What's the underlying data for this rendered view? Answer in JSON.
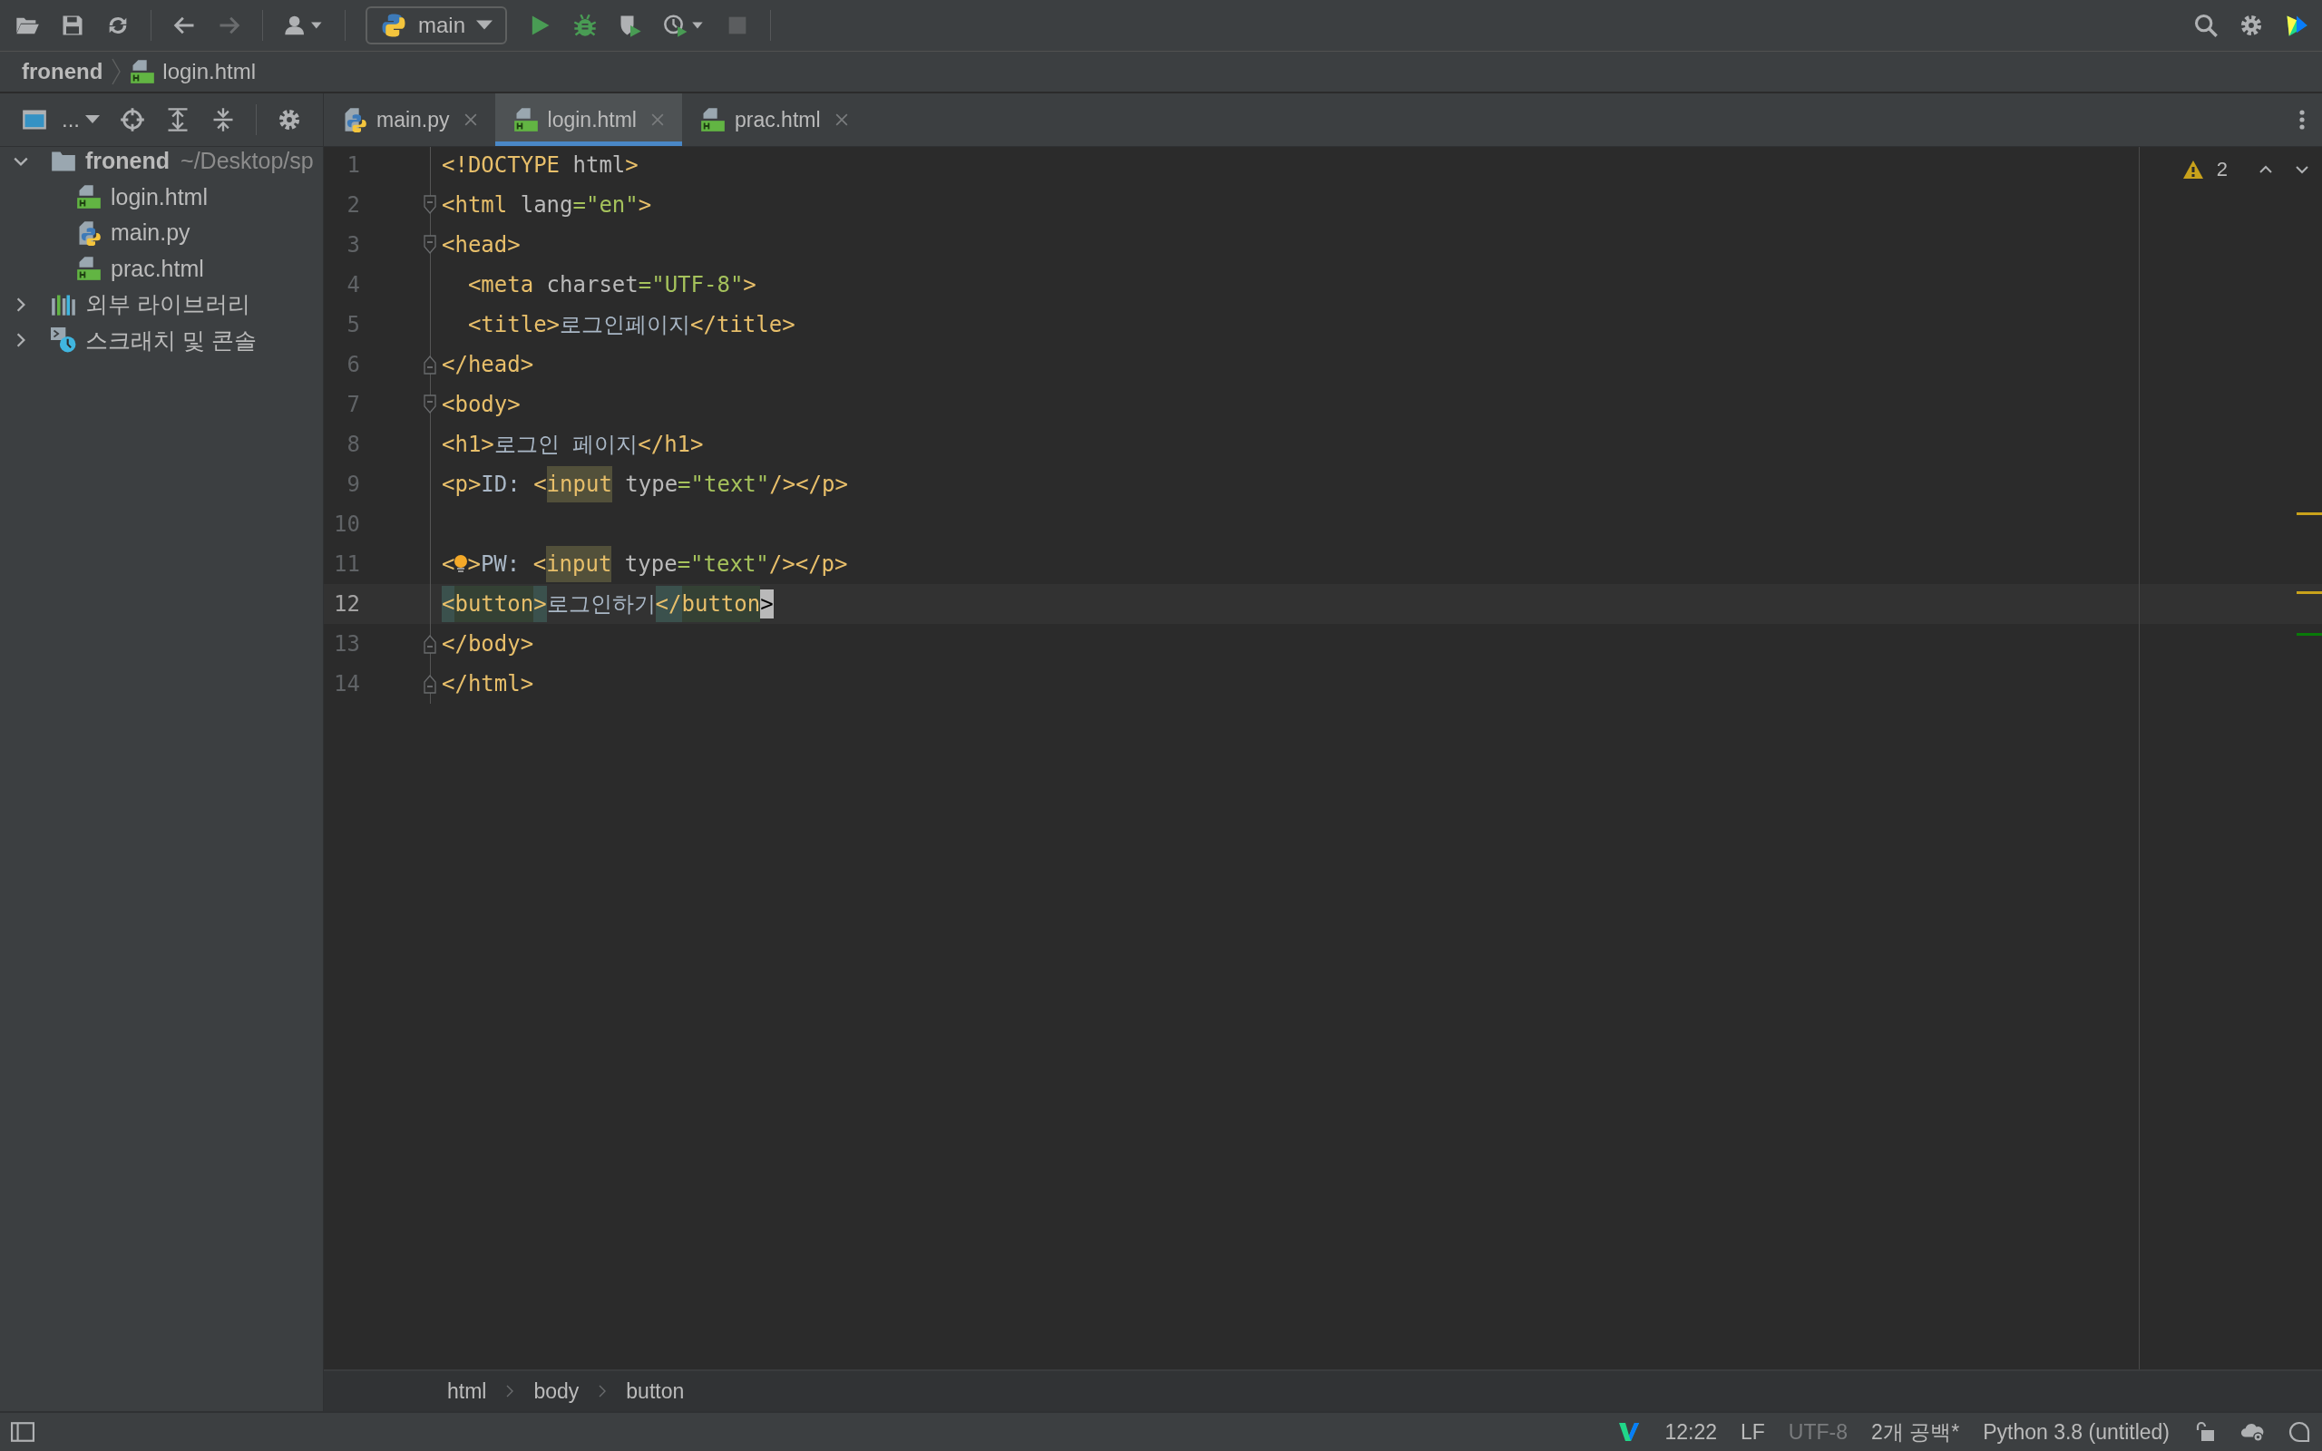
{
  "toolbar": {
    "run_config": "main"
  },
  "navbar": {
    "items": [
      {
        "label": "fronend",
        "kind": "project"
      },
      {
        "label": "login.html",
        "kind": "html"
      }
    ]
  },
  "project_toolbar": {
    "view_label": "..."
  },
  "project_tree": [
    {
      "label": "fronend",
      "path": "~/Desktop/sp",
      "kind": "folder",
      "expanded": true,
      "children": [
        {
          "label": "login.html",
          "kind": "html"
        },
        {
          "label": "main.py",
          "kind": "python"
        },
        {
          "label": "prac.html",
          "kind": "html"
        }
      ]
    },
    {
      "label": "외부 라이브러리",
      "kind": "library",
      "expanded": false
    },
    {
      "label": "스크래치 및 콘솔",
      "kind": "scratch",
      "expanded": false
    }
  ],
  "tabs": [
    {
      "label": "main.py",
      "kind": "python",
      "selected": false
    },
    {
      "label": "login.html",
      "kind": "html",
      "selected": true
    },
    {
      "label": "prac.html",
      "kind": "html",
      "selected": false
    }
  ],
  "inspections": {
    "warnings": "2"
  },
  "editor": {
    "lines": [
      {
        "number": "1",
        "fold_open": false,
        "fold_close": false,
        "current": false,
        "tokens": [
          {
            "text": "<!DOCTYPE ",
            "kind": "tag"
          },
          {
            "text": "html",
            "kind": "attr"
          },
          {
            "text": ">",
            "kind": "tag"
          }
        ]
      },
      {
        "number": "2",
        "fold_open": true,
        "fold_close": false,
        "current": false,
        "tokens": [
          {
            "text": "<html ",
            "kind": "tag"
          },
          {
            "text": "lang",
            "kind": "attr"
          },
          {
            "text": "=\"en\"",
            "kind": "string"
          },
          {
            "text": ">",
            "kind": "tag"
          }
        ]
      },
      {
        "number": "3",
        "fold_open": true,
        "fold_close": false,
        "current": false,
        "tokens": [
          {
            "text": "<head>",
            "kind": "tag"
          }
        ]
      },
      {
        "number": "4",
        "fold_open": false,
        "fold_close": false,
        "current": false,
        "tokens": [
          {
            "text": "  <meta ",
            "kind": "tag"
          },
          {
            "text": "charset",
            "kind": "attr"
          },
          {
            "text": "=\"UTF-8\"",
            "kind": "string"
          },
          {
            "text": ">",
            "kind": "tag"
          }
        ]
      },
      {
        "number": "5",
        "fold_open": false,
        "fold_close": false,
        "current": false,
        "tokens": [
          {
            "text": "  <title>",
            "kind": "tag"
          },
          {
            "text": "로그인페이지",
            "kind": "text"
          },
          {
            "text": "</title>",
            "kind": "tag"
          }
        ]
      },
      {
        "number": "6",
        "fold_open": false,
        "fold_close": true,
        "current": false,
        "tokens": [
          {
            "text": "</head>",
            "kind": "tag"
          }
        ]
      },
      {
        "number": "7",
        "fold_open": true,
        "fold_close": false,
        "current": false,
        "tokens": [
          {
            "text": "<body>",
            "kind": "tag"
          }
        ]
      },
      {
        "number": "8",
        "fold_open": false,
        "fold_close": false,
        "current": false,
        "tokens": [
          {
            "text": "<h1>",
            "kind": "tag"
          },
          {
            "text": "로그인 페이지",
            "kind": "text"
          },
          {
            "text": "</h1>",
            "kind": "tag"
          }
        ]
      },
      {
        "number": "9",
        "fold_open": false,
        "fold_close": false,
        "current": false,
        "tokens": [
          {
            "text": "<p>",
            "kind": "tag"
          },
          {
            "text": "ID: ",
            "kind": "text"
          },
          {
            "text": "<",
            "kind": "tag"
          },
          {
            "text": "input",
            "kind": "usage"
          },
          {
            "text": " type",
            "kind": "attr"
          },
          {
            "text": "=\"text\"",
            "kind": "string"
          },
          {
            "text": "/></p>",
            "kind": "tag"
          }
        ]
      },
      {
        "number": "10",
        "fold_open": false,
        "fold_close": false,
        "current": false
      },
      {
        "number": "11",
        "fold_open": false,
        "fold_close": false,
        "current": false,
        "bulb": true,
        "tokens": [
          {
            "text": "<",
            "kind": "tag"
          },
          {
            "text": ">",
            "kind": "tag"
          },
          {
            "text": "PW: ",
            "kind": "text"
          },
          {
            "text": "<",
            "kind": "tag"
          },
          {
            "text": "input",
            "kind": "usage"
          },
          {
            "text": " type",
            "kind": "attr"
          },
          {
            "text": "=\"text\"",
            "kind": "string"
          },
          {
            "text": "/></p>",
            "kind": "tag"
          }
        ]
      },
      {
        "number": "12",
        "fold_open": false,
        "fold_close": false,
        "current": true,
        "tokens": [
          {
            "text": "<",
            "kind": "match"
          },
          {
            "text": "button",
            "kind": "match-tag"
          },
          {
            "text": ">",
            "kind": "match"
          },
          {
            "text": "로그인하기",
            "kind": "text"
          },
          {
            "text": "</",
            "kind": "match"
          },
          {
            "text": "button",
            "kind": "match-tag"
          },
          {
            "text": ">",
            "kind": "caret"
          }
        ]
      },
      {
        "number": "13",
        "fold_open": false,
        "fold_close": true,
        "current": false,
        "tokens": [
          {
            "text": "</body>",
            "kind": "tag"
          }
        ]
      },
      {
        "number": "14",
        "fold_open": false,
        "fold_close": true,
        "current": false,
        "tokens": [
          {
            "text": "</html>",
            "kind": "tag"
          }
        ]
      }
    ]
  },
  "breadcrumbs": [
    "html",
    "body",
    "button"
  ],
  "status_bar": [
    {
      "label": "12:22",
      "disabled": false
    },
    {
      "label": "LF",
      "disabled": false
    },
    {
      "label": "UTF-8",
      "disabled": true
    },
    {
      "label": "2개 공백*",
      "disabled": false
    },
    {
      "label": "Python 3.8 (untitled)",
      "disabled": false
    }
  ]
}
